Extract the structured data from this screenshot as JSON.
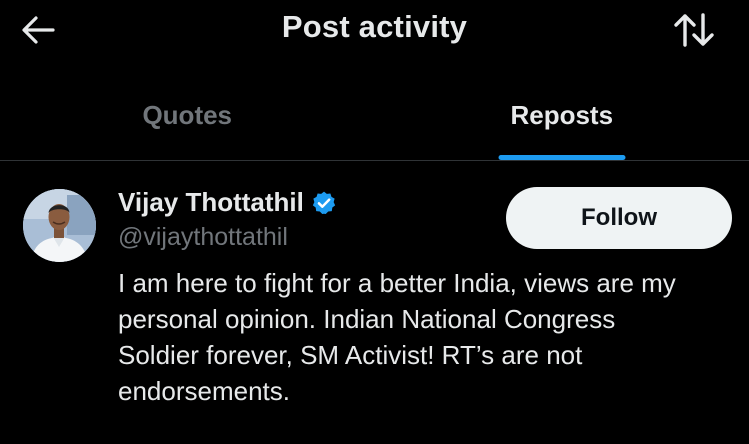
{
  "header": {
    "title": "Post activity",
    "back_icon": "arrow-left-icon",
    "sort_icon": "sort-arrows-icon"
  },
  "tabs": [
    {
      "label": "Quotes",
      "active": false
    },
    {
      "label": "Reposts",
      "active": true
    }
  ],
  "user": {
    "display_name": "Vijay Thottathil",
    "verified": true,
    "handle": "@vijaythottathil",
    "follow_label": "Follow",
    "bio": "I am here to fight for a better India, views are my\npersonal opinion. Indian National Congress\nSoldier forever, SM Activist! RT’s are not\nendorsements."
  },
  "colors": {
    "background": "#000000",
    "text_primary": "#e7e9ea",
    "text_secondary": "#71767b",
    "accent": "#1d9bf0",
    "divider": "#2f3336",
    "follow_bg": "#eff3f4"
  }
}
